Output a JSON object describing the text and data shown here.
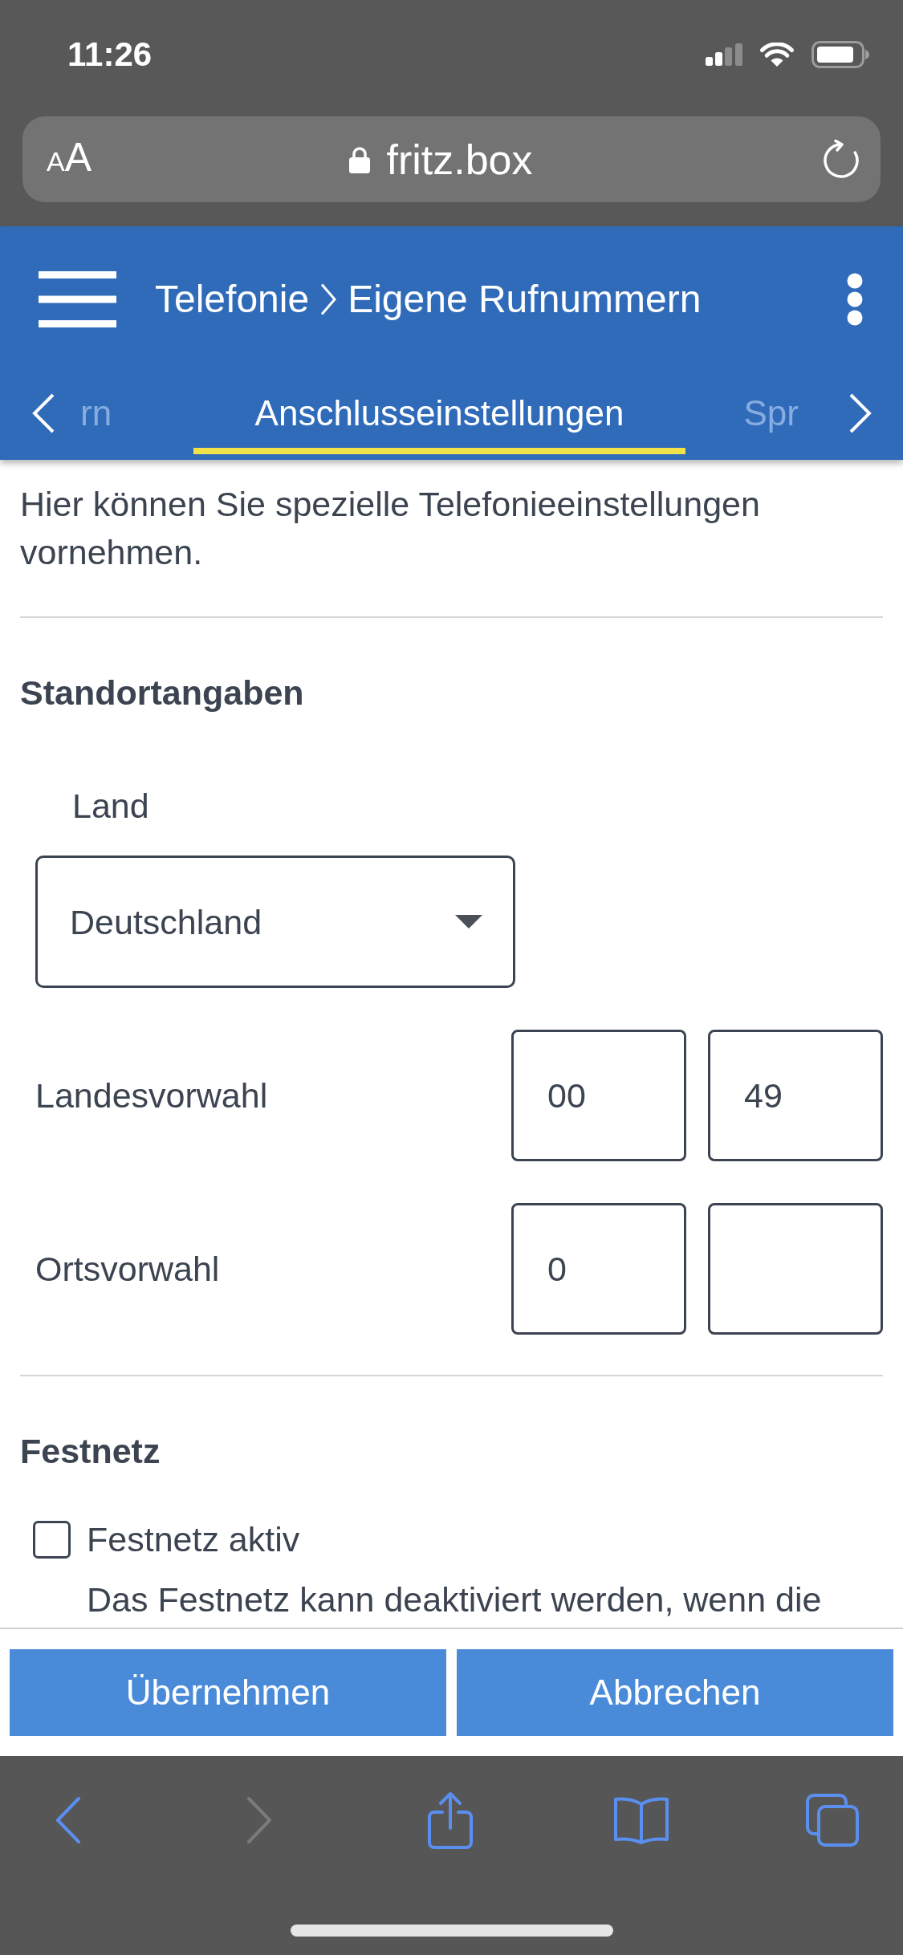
{
  "status_bar": {
    "time": "11:26"
  },
  "address_bar": {
    "text_size_button": "AA",
    "url": "fritz.box"
  },
  "header": {
    "breadcrumb": [
      "Telefonie",
      "Eigene Rufnummern"
    ]
  },
  "tabs": [
    {
      "label": "rn",
      "selected": false
    },
    {
      "label": "Anschlusseinstellungen",
      "selected": true
    },
    {
      "label": "Spr",
      "selected": false
    }
  ],
  "intro": "Hier können Sie spezielle Telefonieeinstellungen vornehmen.",
  "sections": [
    {
      "title": "Standortangaben",
      "fields": [
        {
          "kind": "select",
          "label": "Land",
          "value": "Deutschland"
        },
        {
          "kind": "code_pair",
          "label": "Landesvorwahl",
          "prefix": "00",
          "code": "49"
        },
        {
          "kind": "code_pair",
          "label": "Ortsvorwahl",
          "prefix": "0"
        }
      ]
    },
    {
      "title": "Festnetz",
      "fields": [
        {
          "kind": "checkbox",
          "label": "Festnetz aktiv",
          "checked": false,
          "description": "Das Festnetz kann deaktiviert werden, wenn die"
        }
      ]
    }
  ],
  "action_buttons": [
    "Übernehmen",
    "Abbrechen"
  ],
  "browser_toolbar": [
    {
      "kind": "back",
      "disabled": false
    },
    {
      "kind": "forward",
      "disabled": true
    },
    {
      "kind": "share",
      "disabled": false
    },
    {
      "kind": "bookmarks",
      "disabled": false
    },
    {
      "kind": "tabs",
      "disabled": false
    }
  ]
}
